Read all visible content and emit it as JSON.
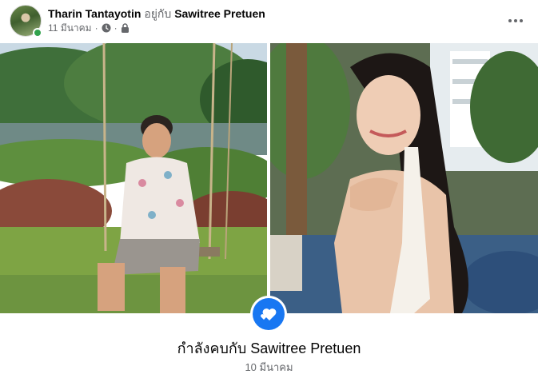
{
  "post": {
    "author": "Tharin Tantayotin",
    "with_word": "อยู่กับ",
    "tagged_person": "Sawitree Pretuen",
    "date": "11 มีนาคม",
    "separator": "·",
    "audience_icon": "clock-icon",
    "privacy_icon": "lock-icon",
    "more_icon": "more-options-icon"
  },
  "photos": [
    {
      "subject": "man-on-swing"
    },
    {
      "subject": "woman-smiling"
    }
  ],
  "life_event": {
    "icon": "hearts-icon",
    "title": "กำลังคบกับ Sawitree Pretuen",
    "date": "10 มีนาคม",
    "accent": "#1877f2"
  }
}
